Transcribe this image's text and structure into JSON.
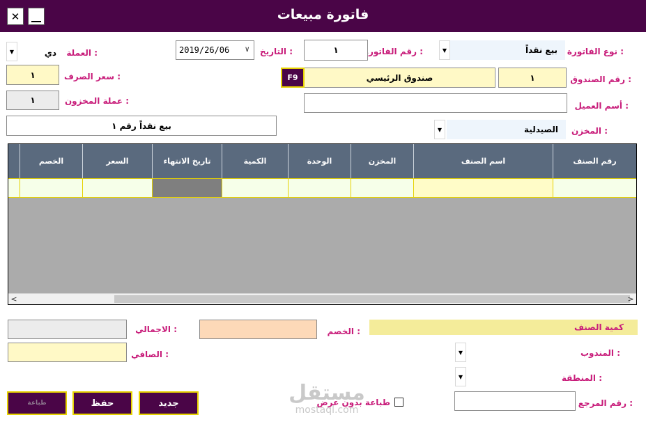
{
  "window": {
    "title": "فاتورة مبيعات",
    "close_glyph": "✕"
  },
  "header": {
    "invoice_type_label": "نوع الفاتورة :",
    "invoice_type_value": "بيع نقداً",
    "invoice_no_label": "رقم الفاتورة :",
    "invoice_no_value": "١",
    "date_label": "التاريخ :",
    "date_value": "2019/26/06",
    "currency_label": "العملة :",
    "currency_value": "دي",
    "exchange_rate_label": "سعر الصرف :",
    "exchange_rate_value": "١",
    "store_currency_label": "عملة المخزون :",
    "store_currency_value": "١",
    "cashbox_no_label": "رقم الصندوق :",
    "cashbox_no_value": "١",
    "cashbox_name_value": "صندوق الرئيسي",
    "f9_label": "F9",
    "customer_label": "أسم العميل :",
    "customer_value": "",
    "store_label": "المخزن :",
    "store_value": "الصيدلية",
    "description_value": "بيع نقداً رقم ١"
  },
  "grid": {
    "columns": [
      "رقم الصنف",
      "اسم الصنف",
      "المخزن",
      "الوحدة",
      "الكمية",
      "تاريخ الانتهاء",
      "السعر",
      "الخصم"
    ],
    "rows": [
      [
        "",
        "",
        "",
        "",
        "",
        "",
        "",
        ""
      ]
    ]
  },
  "footer": {
    "item_qty_label": "كمية الصنف",
    "discount_label": "الخصم :",
    "discount_value": "",
    "total_label": "الاجمالي :",
    "total_value": "",
    "net_label": "الصافي :",
    "net_value": "",
    "rep_label": "المندوب :",
    "region_label": "المنطقة :",
    "reference_label": "رقم المرجع :",
    "reference_value": "",
    "print_no_preview_label": "طباعة بدون عرض",
    "print_no_preview_checked": false
  },
  "buttons": {
    "new": "جديد",
    "save": "حفظ",
    "print": "طباعة"
  },
  "watermark": {
    "brand": "مستقل",
    "url": "mostaql.com"
  },
  "colors": {
    "titlebar": "#4a0547",
    "label_accent": "#c81c7a",
    "button_border": "#e6d200",
    "grid_header": "#5a6a7e"
  }
}
